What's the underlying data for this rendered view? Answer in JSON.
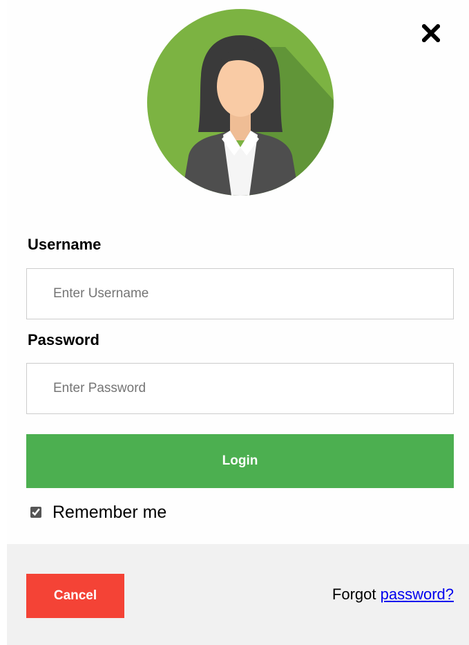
{
  "modal": {
    "close_label": "×",
    "close_icon": "close-x-icon",
    "avatar_icon": "user-avatar-icon"
  },
  "form": {
    "username": {
      "label": "Username",
      "placeholder": "Enter Username",
      "value": ""
    },
    "password": {
      "label": "Password",
      "placeholder": "Enter Password",
      "value": ""
    },
    "login_label": "Login",
    "remember": {
      "label": "Remember me",
      "checked": true
    }
  },
  "footer": {
    "cancel_label": "Cancel",
    "forgot_prefix": "Forgot",
    "forgot_link": "password?"
  },
  "colors": {
    "login_button": "#4caf50",
    "cancel_button": "#f44336",
    "footer_background": "#f1f1f1",
    "link": "#0000ee",
    "avatar_background": "#7cb342"
  }
}
